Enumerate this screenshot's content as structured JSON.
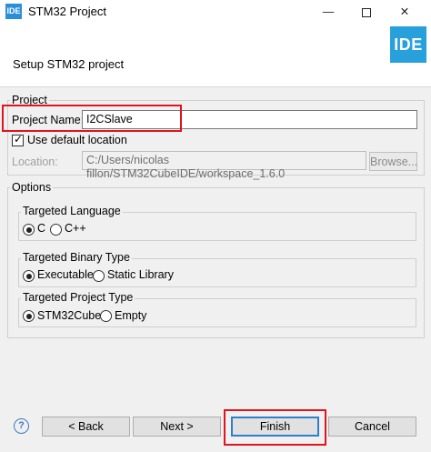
{
  "window": {
    "app_icon_text": "IDE",
    "title": "STM32 Project",
    "minimize": "—",
    "close": "✕"
  },
  "header": {
    "subtitle": "Setup STM32 project",
    "logo_text": "IDE"
  },
  "project_group": {
    "legend": "Project",
    "name_label": "Project Name:",
    "name_value": "I2CSlave",
    "default_location_label": "Use default location",
    "default_location_checked": true,
    "location_label": "Location:",
    "location_value": "C:/Users/nicolas fillon/STM32CubeIDE/workspace_1.6.0",
    "browse_label": "Browse..."
  },
  "options_group": {
    "legend": "Options",
    "language": {
      "legend": "Targeted Language",
      "options": [
        "C",
        "C++"
      ],
      "selected": "C"
    },
    "binary_type": {
      "legend": "Targeted Binary Type",
      "options": [
        "Executable",
        "Static Library"
      ],
      "selected": "Executable"
    },
    "project_type": {
      "legend": "Targeted Project Type",
      "options": [
        "STM32Cube",
        "Empty"
      ],
      "selected": "STM32Cube"
    }
  },
  "footer": {
    "help_icon": "?",
    "back_label": "< Back",
    "next_label": "Next >",
    "finish_label": "Finish",
    "cancel_label": "Cancel"
  },
  "colors": {
    "highlight": "#e0141e",
    "logo": "#27a0dc"
  }
}
